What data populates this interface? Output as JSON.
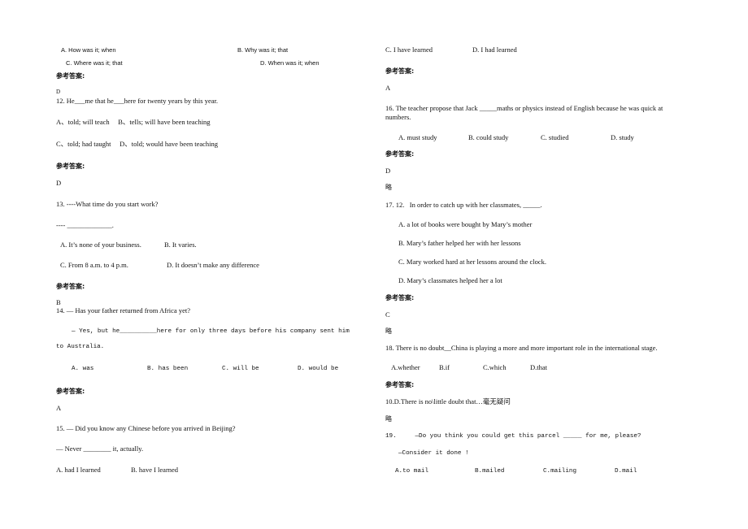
{
  "left": {
    "q11_options": {
      "a": "A. How was it; when",
      "b": "B. Why was it; that",
      "c": "C. Where was it; that",
      "d": "D. When was it; when"
    },
    "q11_answer_label": "参考答案:",
    "q11_answer": "D",
    "q12": {
      "stem": "12. He___me that he___here for twenty years by this year.",
      "options_line1": "A、told; will teach     B、tells; will have been teaching",
      "options_line2": "C、told; had taught     D、told; would have been teaching",
      "answer_label": "参考答案:",
      "answer": "D"
    },
    "q13": {
      "stem": "13. ----What time do you start work?",
      "response": "---- _____________.",
      "option_a": "A. It’s none of your business.",
      "option_b": "B. It varies.",
      "option_c": "C. From 8 a.m. to 4 p.m.",
      "option_d": "D. It doesn’t make any difference",
      "answer_label": "参考答案:",
      "answer": "B"
    },
    "q14": {
      "stem": "14. — Has your father returned from Africa yet?",
      "response_line1": "— Yes, but he__________here for only three days before his company sent him",
      "response_line2": "to Australia.",
      "option_a": "A. was",
      "option_b": "B. has been",
      "option_c": "C. will be",
      "option_d": "D. would be",
      "answer_label": "参考答案:",
      "answer": "A"
    },
    "q15": {
      "stem": "15. — Did you know any Chinese before you arrived in Beijing?",
      "response": "— Never ________ it, actually.",
      "option_a": "A. had I learned",
      "option_b": "B. have I learned"
    }
  },
  "right": {
    "q15_cont": {
      "option_c": "C. I have learned",
      "option_d": "D. I had learned",
      "answer_label": "参考答案:",
      "answer": "A"
    },
    "q16": {
      "stem_line1": "16. The teacher propose that Jack _____maths or physics instead of English because he was quick at",
      "stem_line2": "numbers.",
      "option_a": "A. must study",
      "option_b": "B. could study",
      "option_c": "C. studied",
      "option_d": "D. study",
      "answer_label": "参考答案:",
      "answer": "D",
      "note": "略"
    },
    "q17": {
      "stem": "17. 12.   In order to catch up with her classmates, _____.",
      "option_a": "A. a lot of books were bought by Mary’s mother",
      "option_b": "B. Mary’s father helped her with her lessons",
      "option_c": "C. Mary worked hard at her lessons around the clock.",
      "option_d": "D. Mary’s classmates helped her a lot",
      "answer_label": "参考答案:",
      "answer": "C",
      "note": "略"
    },
    "q18": {
      "stem": "18. There is no doubt__China is playing a more and more important role in the international stage.",
      "option_a": "A.whether",
      "option_b": "B.if",
      "option_c": "C.which",
      "option_d": "D.that",
      "answer_label": "参考答案:",
      "answer": "10.D.There is no\\little doubt that…毫无疑问",
      "note": "略"
    },
    "q19": {
      "stem": "19.     —Do you think you could get this parcel _____ for me, please?",
      "response": "—Consider it done !",
      "option_a": "A.to mail",
      "option_b": "B.mailed",
      "option_c": "C.mailing",
      "option_d": "D.mail"
    }
  }
}
